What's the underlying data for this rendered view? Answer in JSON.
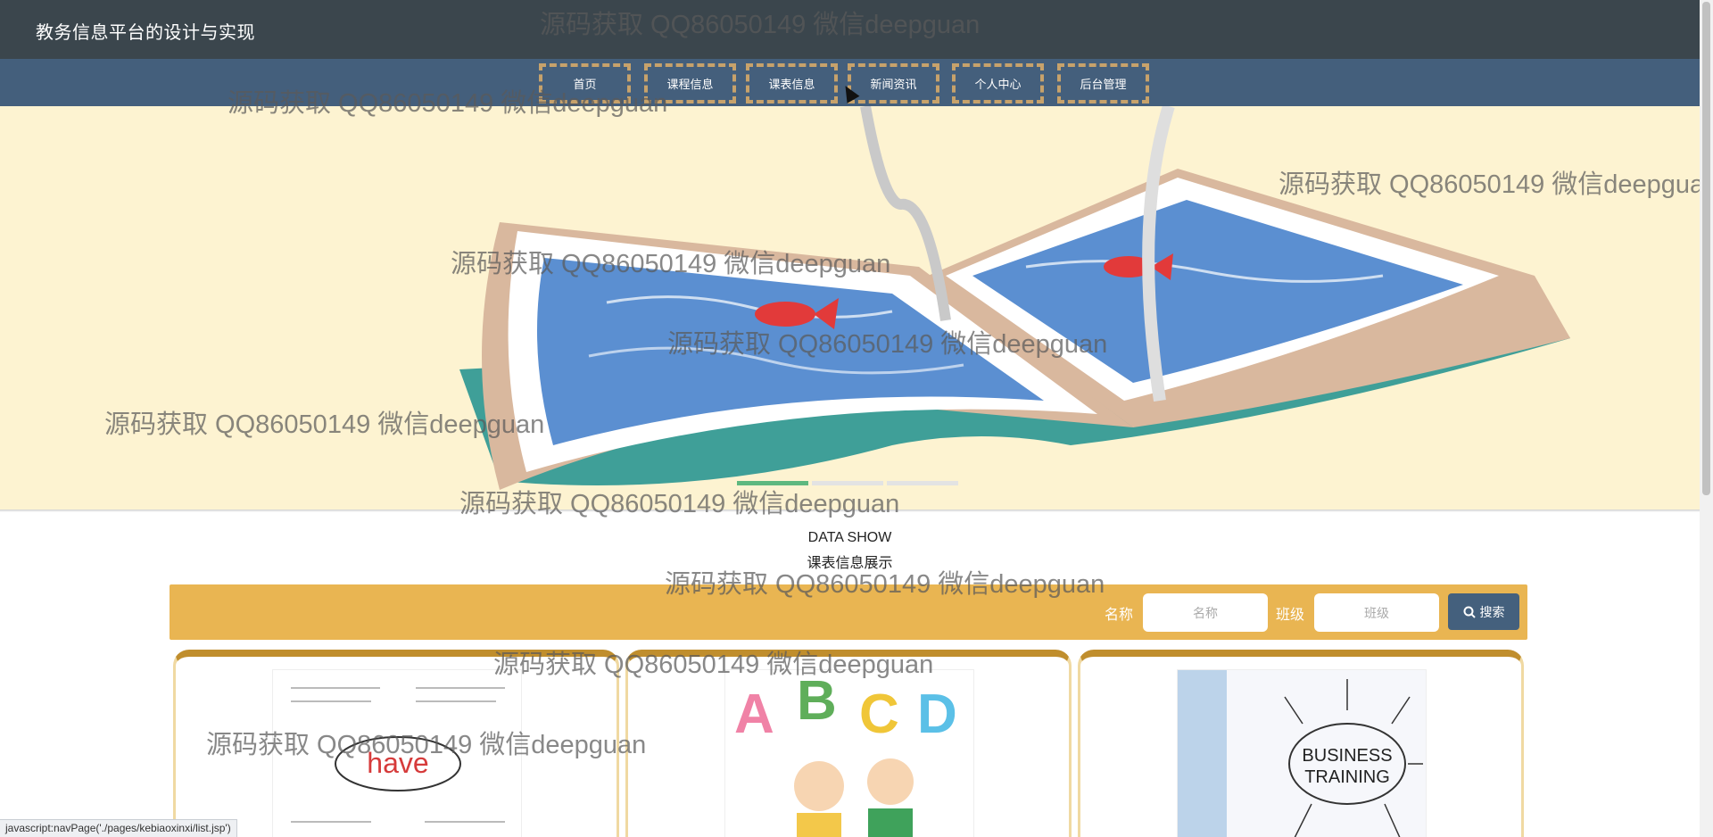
{
  "header": {
    "site_title": "教务信息平台的设计与实现"
  },
  "nav": {
    "items": [
      {
        "label": "首页"
      },
      {
        "label": "课程信息"
      },
      {
        "label": "课表信息"
      },
      {
        "label": "新闻资讯"
      },
      {
        "label": "个人中心"
      },
      {
        "label": "后台管理"
      }
    ]
  },
  "banner": {
    "carousel_slides": 3,
    "active_slide": 1
  },
  "section": {
    "en_title": "DATA SHOW",
    "cn_title": "课表信息展示"
  },
  "search": {
    "name_label": "名称",
    "name_placeholder": "名称",
    "class_label": "班级",
    "class_placeholder": "班级",
    "button_label": "搜索"
  },
  "cards": [
    {
      "image_text": "have"
    },
    {
      "image_text": "A B C D"
    },
    {
      "image_text": "BUSINESS TRAINING"
    }
  ],
  "watermark": {
    "text": "源码获取 QQ86050149 微信deepguan"
  },
  "statusbar": {
    "text": "javascript:navPage('./pages/kebiaoxinxi/list.jsp')"
  },
  "colors": {
    "topbar": "#3b464d",
    "navbar": "#445f7c",
    "nav_border": "#c7a26b",
    "banner_bg": "#fdf3d1",
    "searchbar": "#e9b552",
    "search_button": "#44607d",
    "carousel_active": "#5eb87f"
  }
}
